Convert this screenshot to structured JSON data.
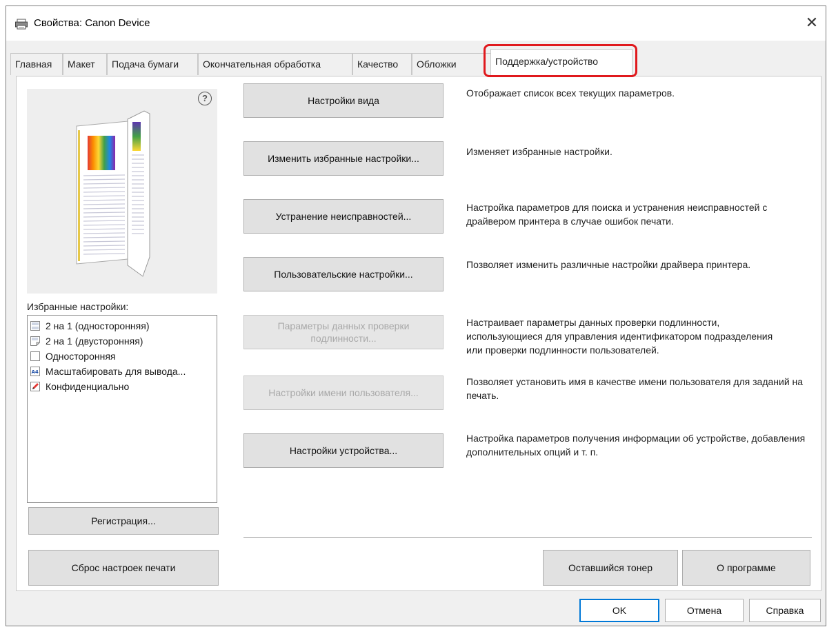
{
  "window": {
    "title": "Свойства: Canon Device",
    "close_glyph": "✕"
  },
  "tabs": [
    {
      "label": "Главная",
      "active": false
    },
    {
      "label": "Макет",
      "active": false
    },
    {
      "label": "Подача бумаги",
      "active": false
    },
    {
      "label": "Окончательная обработка",
      "active": false
    },
    {
      "label": "Качество",
      "active": false
    },
    {
      "label": "Обложки",
      "active": false
    },
    {
      "label": "Поддержка/устройство",
      "active": true
    }
  ],
  "preview": {
    "help_glyph": "?"
  },
  "favorites": {
    "label": "Избранные настройки:",
    "items": [
      {
        "label": "2 на 1 (односторонняя)",
        "icon": "layout-2in1-icon"
      },
      {
        "label": "2 на 1 (двусторонняя)",
        "icon": "layout-duplex-icon"
      },
      {
        "label": "Односторонняя",
        "icon": "blank-page-icon"
      },
      {
        "label": "Масштабировать для вывода...",
        "icon": "a4-scale-icon"
      },
      {
        "label": "Конфиденциально",
        "icon": "pencil-icon"
      }
    ],
    "register_button": "Регистрация...",
    "reset_button": "Сброс настроек печати"
  },
  "actions": [
    {
      "button": "Настройки вида",
      "enabled": true,
      "description": "Отображает список всех текущих параметров."
    },
    {
      "button": "Изменить избранные настройки...",
      "enabled": true,
      "description": "Изменяет избранные настройки."
    },
    {
      "button": "Устранение неисправностей...",
      "enabled": true,
      "description": "Настройка параметров для поиска и устранения неисправностей с драйвером принтера в случае ошибок печати."
    },
    {
      "button": "Пользовательские настройки...",
      "enabled": true,
      "description": "Позволяет изменить различные настройки драйвера принтера."
    },
    {
      "button": "Параметры данных проверки подлинности...",
      "enabled": false,
      "description": "Настраивает параметры данных проверки подлинности, использующиеся для управления идентификатором подразделения или проверки подлинности пользователей."
    },
    {
      "button": "Настройки имени пользователя...",
      "enabled": false,
      "description": "Позволяет установить имя в качестве имени пользователя для заданий на печать."
    },
    {
      "button": "Настройки устройства...",
      "enabled": true,
      "description": "Настройка параметров получения информации об устройстве, добавления дополнительных опций и т. п."
    }
  ],
  "bottom_buttons": {
    "toner": "Оставшийся тонер",
    "about": "О программе"
  },
  "dialog_buttons": {
    "ok": "OK",
    "cancel": "Отмена",
    "help": "Справка"
  },
  "colors": {
    "highlight": "#e0191d",
    "default_button_border": "#0078d7"
  }
}
